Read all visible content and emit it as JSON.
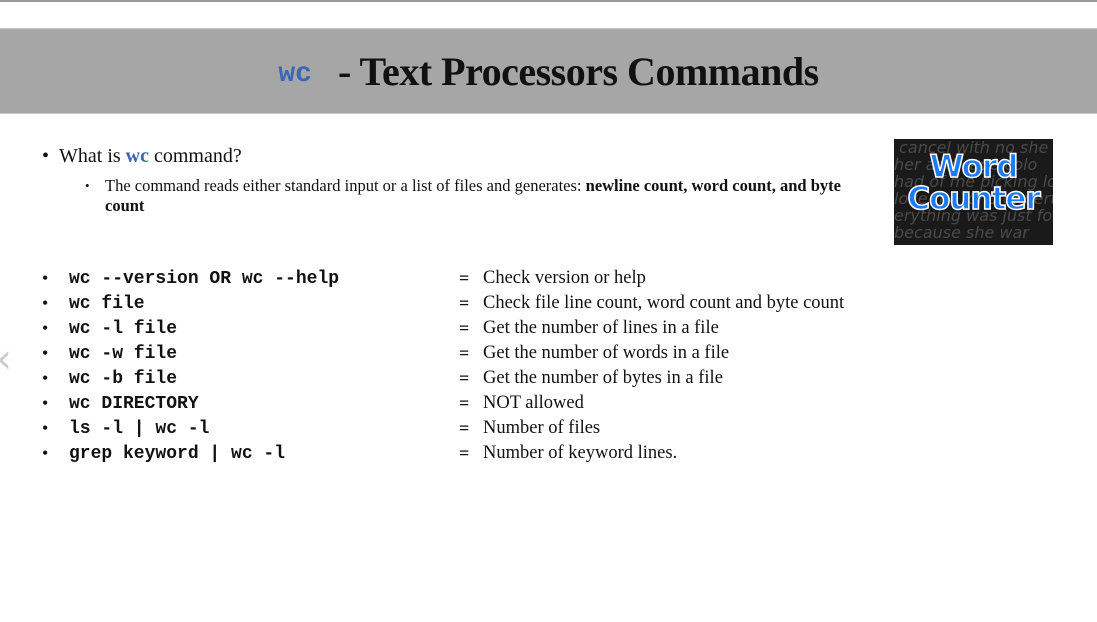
{
  "title": {
    "command": "wc",
    "text": "- Text Processors Commands"
  },
  "intro": {
    "prefix": "What is ",
    "keyword": "wc",
    "suffix": " command?",
    "detail_plain": "The command reads either standard input or a list of files and generates: ",
    "detail_bold": "newline count, word count, and byte count"
  },
  "image": {
    "label_line1": "Word",
    "label_line2": "Counter"
  },
  "commands": [
    {
      "cmd": "wc --version OR wc --help",
      "desc": "Check version or help"
    },
    {
      "cmd": "wc file",
      "desc": "Check file line count, word count and byte count"
    },
    {
      "cmd": "wc -l file",
      "desc": "Get the number of lines in a file"
    },
    {
      "cmd": "wc -w file",
      "desc": "Get the number of words in a file"
    },
    {
      "cmd": "wc -b file",
      "desc": "Get the number of bytes in a file"
    },
    {
      "cmd": "wc DIRECTORY",
      "desc": "NOT allowed"
    },
    {
      "cmd": "ls -l | wc -l",
      "desc": "Number of files"
    },
    {
      "cmd": "grep keyword | wc -l",
      "desc": "Number of keyword lines."
    }
  ],
  "symbols": {
    "bullet": "•",
    "equals": "=",
    "prev": "‹"
  },
  "colors": {
    "accent": "#3a66b4",
    "title_bar": "#a6a6a6"
  }
}
